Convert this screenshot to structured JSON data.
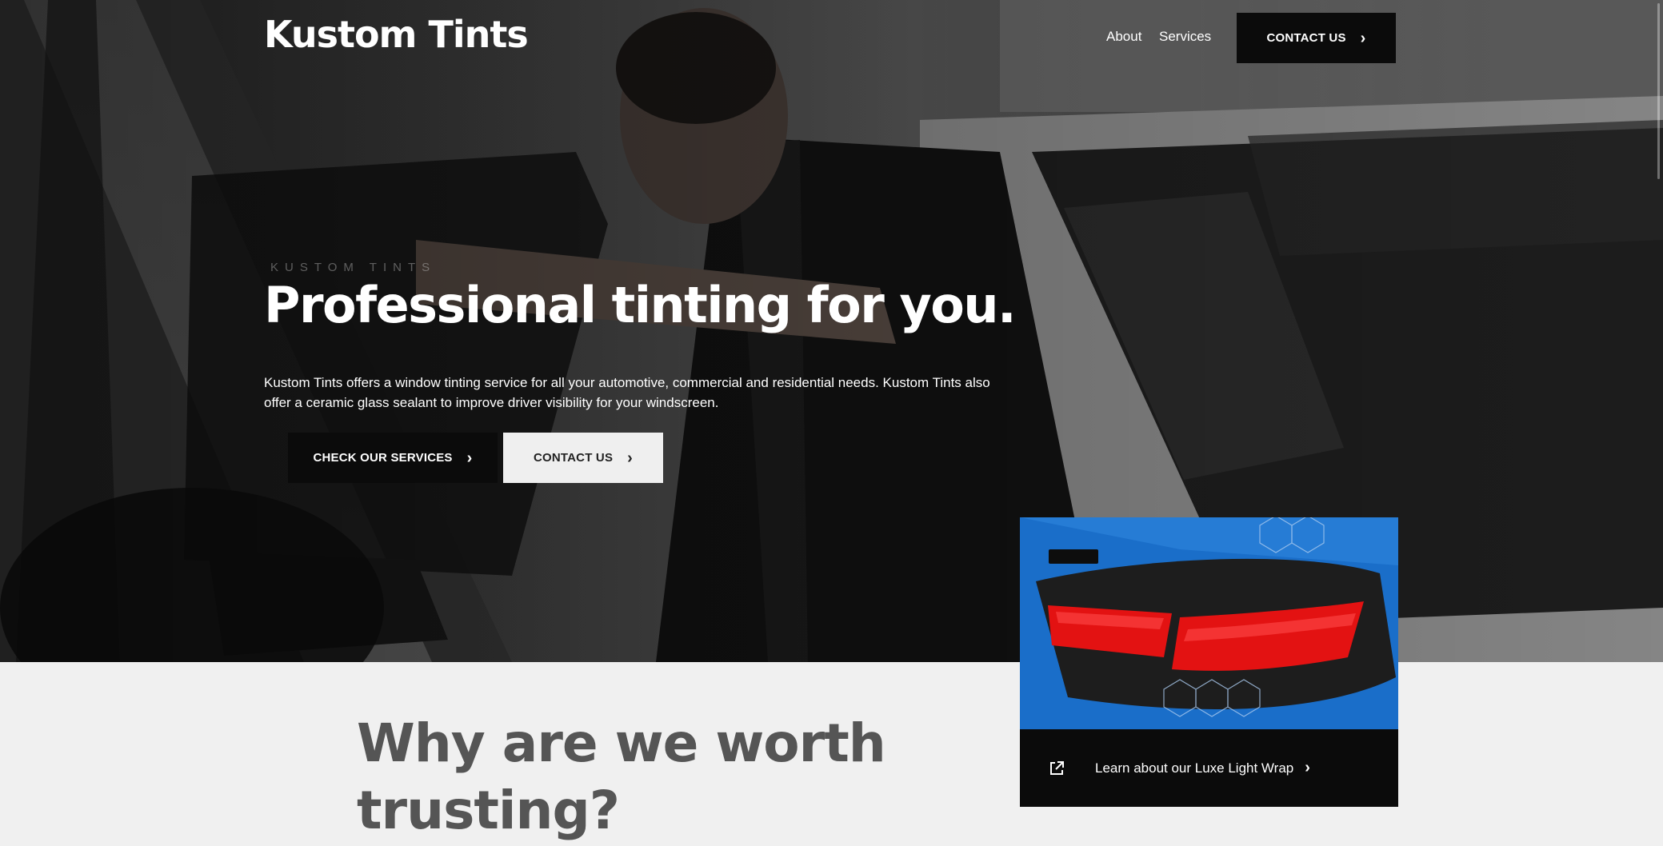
{
  "header": {
    "brand": "Kustom Tints",
    "nav": [
      {
        "label": "About"
      },
      {
        "label": "Services"
      }
    ],
    "contact_button": "CONTACT US"
  },
  "hero": {
    "eyebrow": "KUSTOM TINTS",
    "headline": "Professional tinting for you.",
    "lede": "Kustom Tints offers a window tinting service for all your automotive, commercial and residential needs. Kustom Tints also offer a ceramic glass sealant to improve driver visibility for your windscreen.",
    "primary_button": "CHECK OUR SERVICES",
    "secondary_button": "CONTACT US",
    "chevron": "›"
  },
  "promo": {
    "link_text": "Learn about our Luxe Light Wrap",
    "icon": "external-link-icon"
  },
  "why": {
    "heading": "Why are we worth trusting?"
  },
  "colors": {
    "dark": "#0b0b0b",
    "light_button": "#efefef",
    "section_bg": "#f0f0f0",
    "heading_gray": "#555555",
    "car_blue": "#1a6ec9",
    "tail_red": "#e31212"
  }
}
